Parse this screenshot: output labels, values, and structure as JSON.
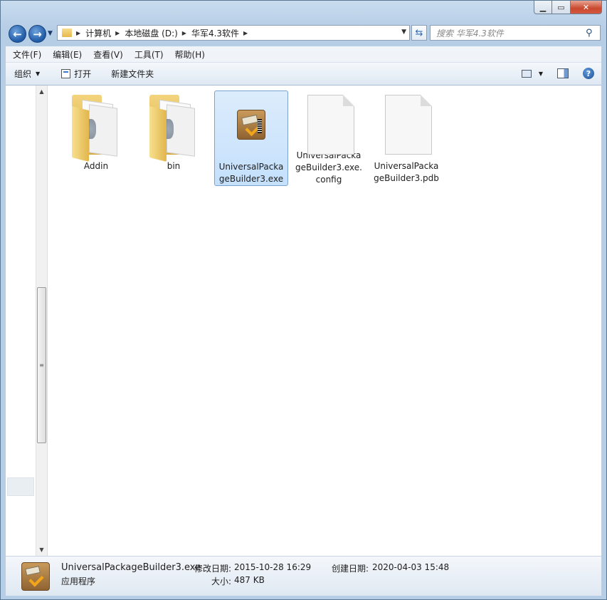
{
  "nav": {
    "breadcrumbs": [
      "计算机",
      "本地磁盘 (D:)",
      "华军4.3软件"
    ],
    "search_placeholder": "搜索 华军4.3软件"
  },
  "menu": [
    "文件(F)",
    "编辑(E)",
    "查看(V)",
    "工具(T)",
    "帮助(H)"
  ],
  "toolbar": {
    "organize": "组织",
    "open": "打开",
    "new_folder": "新建文件夹"
  },
  "files": [
    {
      "name": "Addin",
      "type": "folder"
    },
    {
      "name": "bin",
      "type": "folder"
    },
    {
      "name": "UniversalPackageBuilder3.exe",
      "type": "exe",
      "selected": true
    },
    {
      "name": "UniversalPackageBuilder3.exe.config",
      "type": "file"
    },
    {
      "name": "UniversalPackageBuilder3.pdb",
      "type": "file"
    }
  ],
  "status": {
    "filename": "UniversalPackageBuilder3.exe",
    "type": "应用程序",
    "modified_label": "修改日期:",
    "modified_value": "2015-10-28 16:29",
    "created_label": "创建日期:",
    "created_value": "2020-04-03 15:48",
    "size_label": "大小:",
    "size_value": "487 KB"
  }
}
